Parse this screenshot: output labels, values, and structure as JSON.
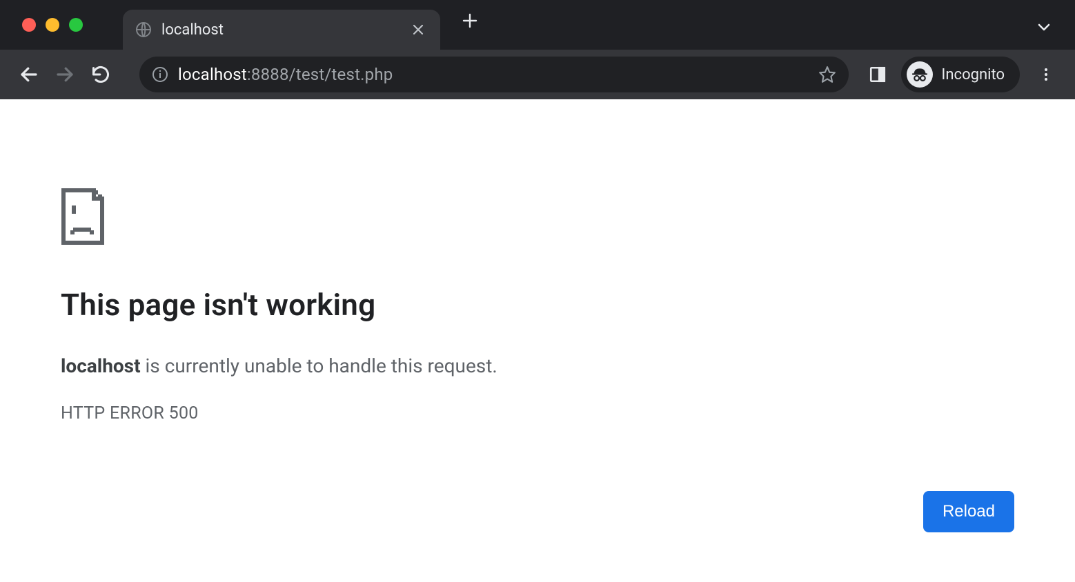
{
  "browser": {
    "tab": {
      "title": "localhost"
    },
    "url": {
      "host": "localhost",
      "path": ":8888/test/test.php"
    },
    "incognito_label": "Incognito"
  },
  "error": {
    "title": "This page isn't working",
    "host": "localhost",
    "message_rest": " is currently unable to handle this request.",
    "code": "HTTP ERROR 500",
    "reload_label": "Reload"
  }
}
